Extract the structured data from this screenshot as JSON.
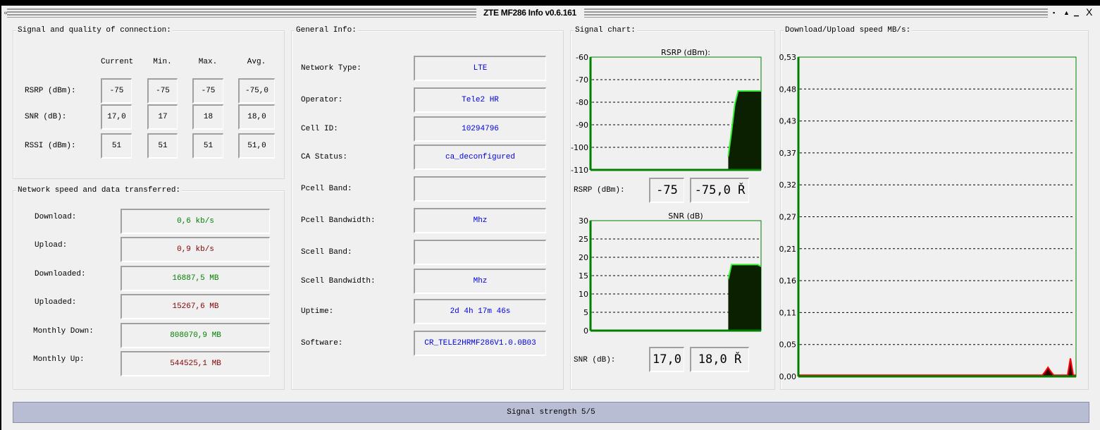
{
  "window": {
    "title": "ZTE MF286 Info v0.6.161",
    "controls": [
      "▪",
      "▲",
      "▁",
      "X"
    ]
  },
  "signal": {
    "title": "Signal and quality of connection:",
    "columns": [
      "Current",
      "Min.",
      "Max.",
      "Avg."
    ],
    "rows": [
      {
        "label": "RSRP (dBm):",
        "values": [
          "-75",
          "-75",
          "-75",
          "-75,0"
        ]
      },
      {
        "label": "SNR (dB):",
        "values": [
          "17,0",
          "17",
          "18",
          "18,0"
        ]
      },
      {
        "label": "RSSI (dBm):",
        "values": [
          "51",
          "51",
          "51",
          "51,0"
        ]
      }
    ]
  },
  "speed": {
    "title": "Network speed and data transferred:",
    "rows": [
      {
        "label": "Download:",
        "value": "0,6 kb/s",
        "color": "green"
      },
      {
        "label": "Upload:",
        "value": "0,9 kb/s",
        "color": "red"
      },
      {
        "label": "Downloaded:",
        "value": "16887,5 MB",
        "color": "green"
      },
      {
        "label": "Uploaded:",
        "value": "15267,6 MB",
        "color": "red"
      },
      {
        "label": "Monthly Down:",
        "value": "808070,9 MB",
        "color": "green"
      },
      {
        "label": "Monthly Up:",
        "value": "544525,1 MB",
        "color": "red"
      }
    ]
  },
  "info": {
    "title": "General Info:",
    "rows": [
      {
        "label": "Network Type:",
        "value": "LTE"
      },
      {
        "label": "Operator:",
        "value": "Tele2 HR"
      },
      {
        "label": "Cell ID:",
        "value": "10294796"
      },
      {
        "label": "CA Status:",
        "value": "ca_deconfigured"
      },
      {
        "label": "Pcell Band:",
        "value": ""
      },
      {
        "label": "Pcell Bandwidth:",
        "value": "Mhz"
      },
      {
        "label": "Scell Band:",
        "value": ""
      },
      {
        "label": "Scell Bandwidth:",
        "value": "Mhz"
      },
      {
        "label": "Uptime:",
        "value": "2d 4h 17m 46s"
      },
      {
        "label": "Software:",
        "value": "CR_TELE2HRMF286V1.0.0B03"
      }
    ]
  },
  "signal_chart": {
    "title": "Signal chart:",
    "rsrp": {
      "label": "RSRP (dBm):",
      "current": "-75",
      "avg": "-75,0 Ř"
    },
    "snr": {
      "label": "SNR (dB):",
      "current": "17,0",
      "avg": "18,0 Ř"
    }
  },
  "speed_chart": {
    "title": "Download/Upload speed MB/s:"
  },
  "chart_data": [
    {
      "type": "area",
      "title": "RSRP (dBm):",
      "ylim": [
        -110,
        -60
      ],
      "yticks": [
        "-60",
        "-70",
        "-80",
        "-90",
        "-100",
        "-110"
      ],
      "tickvals": [
        -60,
        -70,
        -80,
        -90,
        -100,
        -110
      ],
      "grid": [
        -70,
        -80,
        -90,
        -100
      ],
      "series": [
        {
          "name": "RSRP",
          "color": "#33ee33",
          "fill": "#0a2000",
          "values": [
            null,
            null,
            null,
            null,
            null,
            null,
            null,
            null,
            null,
            null,
            null,
            null,
            null,
            null,
            null,
            null,
            null,
            null,
            null,
            null,
            null,
            null,
            null,
            null,
            null,
            null,
            null,
            null,
            null,
            null,
            null,
            null,
            null,
            null,
            null,
            null,
            null,
            null,
            null,
            null,
            null,
            null,
            -104,
            -93,
            -81,
            -75,
            -75,
            -75,
            -75,
            -75,
            -75,
            -75,
            -75
          ]
        }
      ]
    },
    {
      "type": "area",
      "title": "SNR (dB)",
      "ylim": [
        0,
        30
      ],
      "yticks": [
        "30",
        "25",
        "20",
        "15",
        "10",
        "5",
        "0"
      ],
      "tickvals": [
        30,
        25,
        20,
        15,
        10,
        5,
        0
      ],
      "grid": [
        25,
        20,
        15,
        10,
        5
      ],
      "series": [
        {
          "name": "SNR",
          "color": "#33ee33",
          "fill": "#0a2000",
          "values": [
            null,
            null,
            null,
            null,
            null,
            null,
            null,
            null,
            null,
            null,
            null,
            null,
            null,
            null,
            null,
            null,
            null,
            null,
            null,
            null,
            null,
            null,
            null,
            null,
            null,
            null,
            null,
            null,
            null,
            null,
            null,
            null,
            null,
            null,
            null,
            null,
            null,
            null,
            null,
            null,
            null,
            null,
            14,
            18,
            18,
            18,
            18,
            18,
            18,
            18,
            18,
            18,
            17.5
          ]
        }
      ]
    },
    {
      "type": "area",
      "title": "Download/Upload speed MB/s:",
      "ylim": [
        0,
        0.53
      ],
      "yticks": [
        "0,53",
        "0,48",
        "0,43",
        "0,37",
        "0,32",
        "0,27",
        "0,21",
        "0,16",
        "0,11",
        "0,05",
        "0,00"
      ],
      "tickvals": [
        0.53,
        0.477,
        0.424,
        0.371,
        0.318,
        0.265,
        0.212,
        0.159,
        0.106,
        0.053,
        0
      ],
      "grid": [
        0.477,
        0.424,
        0.371,
        0.318,
        0.265,
        0.212,
        0.159,
        0.106,
        0.053
      ],
      "series": [
        {
          "name": "Download",
          "color": "#33ee33",
          "fill": "#0a2000",
          "values": [
            0,
            0,
            0,
            0,
            0,
            0,
            0,
            0,
            0,
            0,
            0,
            0,
            0,
            0,
            0,
            0,
            0,
            0,
            0,
            0,
            0,
            0,
            0,
            0,
            0,
            0,
            0,
            0,
            0,
            0,
            0,
            0,
            0,
            0,
            0,
            0,
            0,
            0,
            0,
            0,
            0,
            0,
            0,
            0,
            0,
            0,
            0,
            0,
            0,
            0,
            0,
            0,
            0,
            0,
            0,
            0,
            0,
            0,
            0,
            0,
            0,
            0,
            0,
            0,
            0,
            0,
            0,
            0,
            0,
            0,
            0,
            0,
            0,
            0,
            0,
            0,
            0,
            0,
            0,
            0,
            0,
            0,
            0,
            0,
            0,
            0,
            0,
            0,
            0,
            0,
            0,
            0,
            0,
            0,
            0,
            0,
            0,
            0,
            0,
            0
          ]
        },
        {
          "name": "Upload",
          "color": "#ff0000",
          "fill": "#3a0000",
          "values": [
            0.002,
            0.002,
            0.002,
            0.002,
            0.002,
            0.002,
            0.002,
            0.002,
            0.002,
            0.002,
            0.002,
            0.002,
            0.002,
            0.002,
            0.002,
            0.002,
            0.002,
            0.002,
            0.002,
            0.002,
            0.002,
            0.002,
            0.002,
            0.002,
            0.002,
            0.002,
            0.002,
            0.002,
            0.002,
            0.002,
            0.002,
            0.002,
            0.002,
            0.002,
            0.002,
            0.002,
            0.002,
            0.002,
            0.002,
            0.002,
            0.002,
            0.002,
            0.002,
            0.002,
            0.002,
            0.002,
            0.002,
            0.002,
            0.002,
            0.002,
            0.002,
            0.002,
            0.002,
            0.002,
            0.002,
            0.002,
            0.002,
            0.002,
            0.002,
            0.002,
            0.002,
            0.002,
            0.002,
            0.002,
            0.002,
            0.002,
            0.002,
            0.002,
            0.002,
            0.002,
            0.002,
            0.002,
            0.002,
            0.002,
            0.002,
            0.002,
            0.002,
            0.002,
            0.002,
            0.002,
            0.002,
            0.002,
            0.002,
            0.002,
            0.002,
            0.002,
            0.002,
            0.002,
            0.008,
            0.015,
            0.008,
            0.002,
            0.002,
            0.002,
            0.002,
            0.002,
            0.002,
            0.03,
            0.002,
            0.002
          ]
        }
      ]
    }
  ],
  "status": {
    "text": "Signal strength 5/5"
  }
}
